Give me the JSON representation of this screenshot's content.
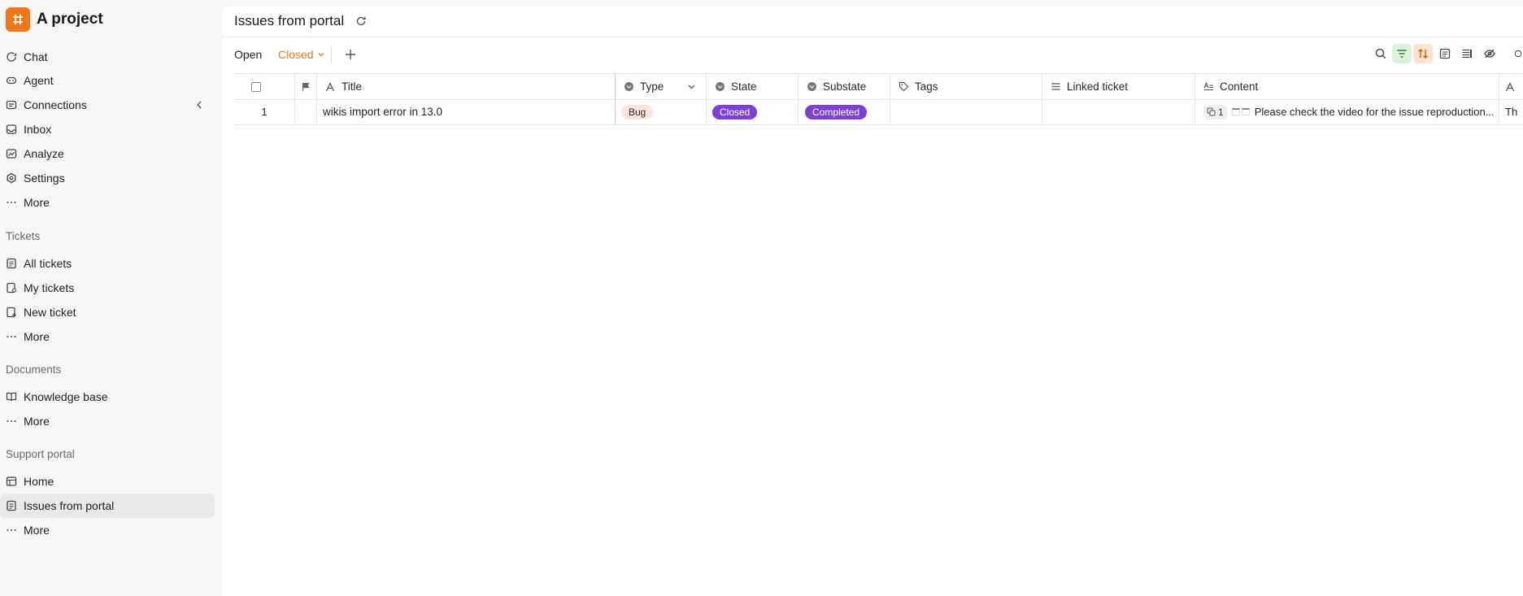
{
  "sidebar": {
    "project_title": "A project",
    "main_items": [
      {
        "label": "Chat",
        "icon": "chat-icon"
      },
      {
        "label": "Agent",
        "icon": "agent-icon"
      },
      {
        "label": "Connections",
        "icon": "connections-icon"
      },
      {
        "label": "Inbox",
        "icon": "inbox-icon"
      },
      {
        "label": "Analyze",
        "icon": "analyze-icon"
      },
      {
        "label": "Settings",
        "icon": "settings-icon"
      },
      {
        "label": "More",
        "icon": "more-icon"
      }
    ],
    "tickets_section": {
      "title": "Tickets",
      "items": [
        {
          "label": "All tickets",
          "icon": "tickets-list-icon"
        },
        {
          "label": "My tickets",
          "icon": "my-tickets-icon"
        },
        {
          "label": "New ticket",
          "icon": "new-ticket-icon"
        },
        {
          "label": "More",
          "icon": "more-icon"
        }
      ]
    },
    "documents_section": {
      "title": "Documents",
      "items": [
        {
          "label": "Knowledge base",
          "icon": "book-icon"
        },
        {
          "label": "More",
          "icon": "more-icon"
        }
      ]
    },
    "portal_section": {
      "title": "Support portal",
      "items": [
        {
          "label": "Home",
          "icon": "home-icon"
        },
        {
          "label": "Issues from portal",
          "icon": "issues-list-icon",
          "active": true
        },
        {
          "label": "More",
          "icon": "more-icon"
        }
      ]
    }
  },
  "header": {
    "title": "Issues from portal"
  },
  "views": {
    "open": "Open",
    "closed": "Closed",
    "active": "Closed"
  },
  "colors": {
    "brand": "#f0761b",
    "active_tab": "#e8781a",
    "state_pill": "#7e3fd4",
    "bug_pill": "#fde2e2",
    "filter_active": "#d9f2d9",
    "sort_active": "#fde3cf"
  },
  "table": {
    "columns": [
      {
        "label": "Title",
        "icon": "text-icon"
      },
      {
        "label": "Type",
        "icon": "select-icon"
      },
      {
        "label": "State",
        "icon": "select-icon"
      },
      {
        "label": "Substate",
        "icon": "select-icon"
      },
      {
        "label": "Tags",
        "icon": "tag-icon"
      },
      {
        "label": "Linked ticket",
        "icon": "link-list-icon"
      },
      {
        "label": "Content",
        "icon": "rich-text-icon"
      }
    ],
    "rows": [
      {
        "number": "1",
        "title": "wikis import error in 13.0",
        "type": "Bug",
        "state": "Closed",
        "substate": "Completed",
        "tags": "",
        "linked_ticket": "",
        "content_attachments": "1",
        "content": "Please check the video for the issue reproduction...",
        "next_col_fragment": "Th"
      }
    ]
  }
}
